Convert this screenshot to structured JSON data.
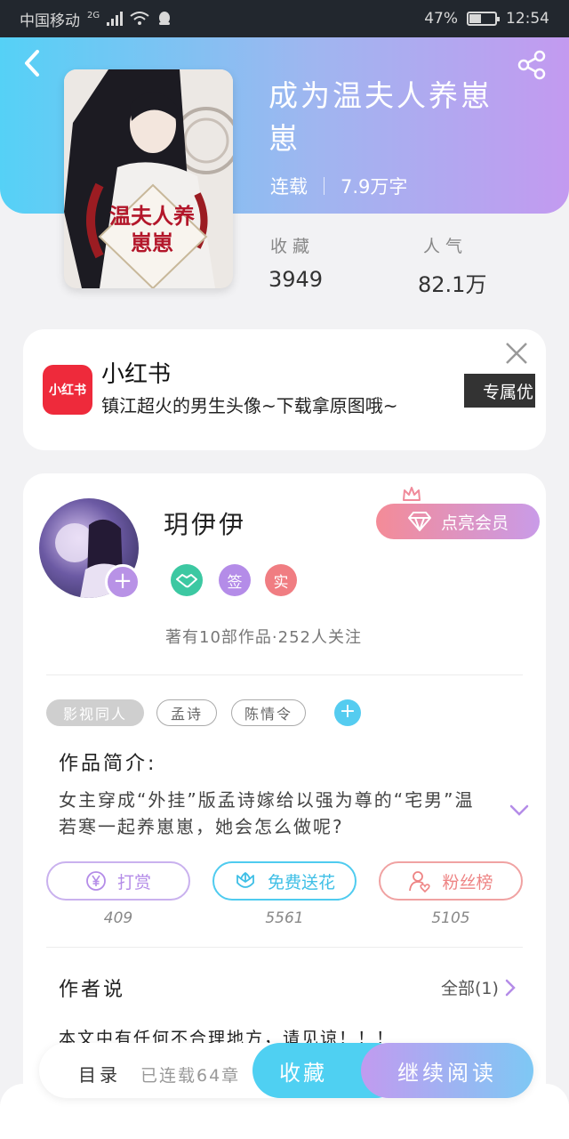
{
  "status_bar": {
    "carrier": "中国移动",
    "network": "2G",
    "battery_percent": "47%",
    "battery_level": 0.47,
    "time": "12:54"
  },
  "book": {
    "title": "成为温夫人养崽崽",
    "status": "连载",
    "word_count": "7.9万字",
    "cover_title": "温夫人养崽崽",
    "favorites_label": "收藏",
    "favorites_value": "3949",
    "popularity_label": "人气",
    "popularity_value": "82.1万"
  },
  "ad": {
    "logo_text": "小红书",
    "title": "小红书",
    "description": "镇江超火的男生头像~下载拿原图哦~",
    "button_label": "专属优"
  },
  "author": {
    "name": "玥伊伊",
    "vip_button_label": "点亮会员",
    "badges": [
      {
        "text": "",
        "icon": "handshake-icon",
        "color": "#3cc8a2"
      },
      {
        "text": "签",
        "color": "#b48ce8"
      },
      {
        "text": "实",
        "color": "#f07d82"
      }
    ],
    "stats": "著有10部作品·252人关注"
  },
  "tags": [
    "影视同人",
    "孟诗",
    "陈情令"
  ],
  "intro": {
    "title": "作品简介:",
    "text": "女主穿成“外挂”版孟诗嫁给以强为尊的“宅男”温若寒一起养崽崽，她会怎么做呢?"
  },
  "actions": [
    {
      "label": "打赏",
      "count": "409",
      "color": "#b48ce8",
      "icon": "yen-icon"
    },
    {
      "label": "免费送花",
      "count": "5561",
      "color": "#4fcbef",
      "icon": "flower-icon"
    },
    {
      "label": "粉丝榜",
      "count": "5105",
      "color": "#f08a8a",
      "icon": "fans-icon"
    }
  ],
  "author_says": {
    "title": "作者说",
    "all_label": "全部(1)",
    "text": "本文中有任何不合理地方，请见谅！！！"
  },
  "bottom": {
    "toc_label": "目录",
    "chapters": "已连载64章",
    "collect_label": "收藏",
    "read_label": "继续阅读"
  },
  "colors": {
    "header_start": "#55d1f6",
    "header_end": "#c39af0",
    "accent_blue": "#4fd0f2",
    "accent_purple": "#c19bf0"
  }
}
